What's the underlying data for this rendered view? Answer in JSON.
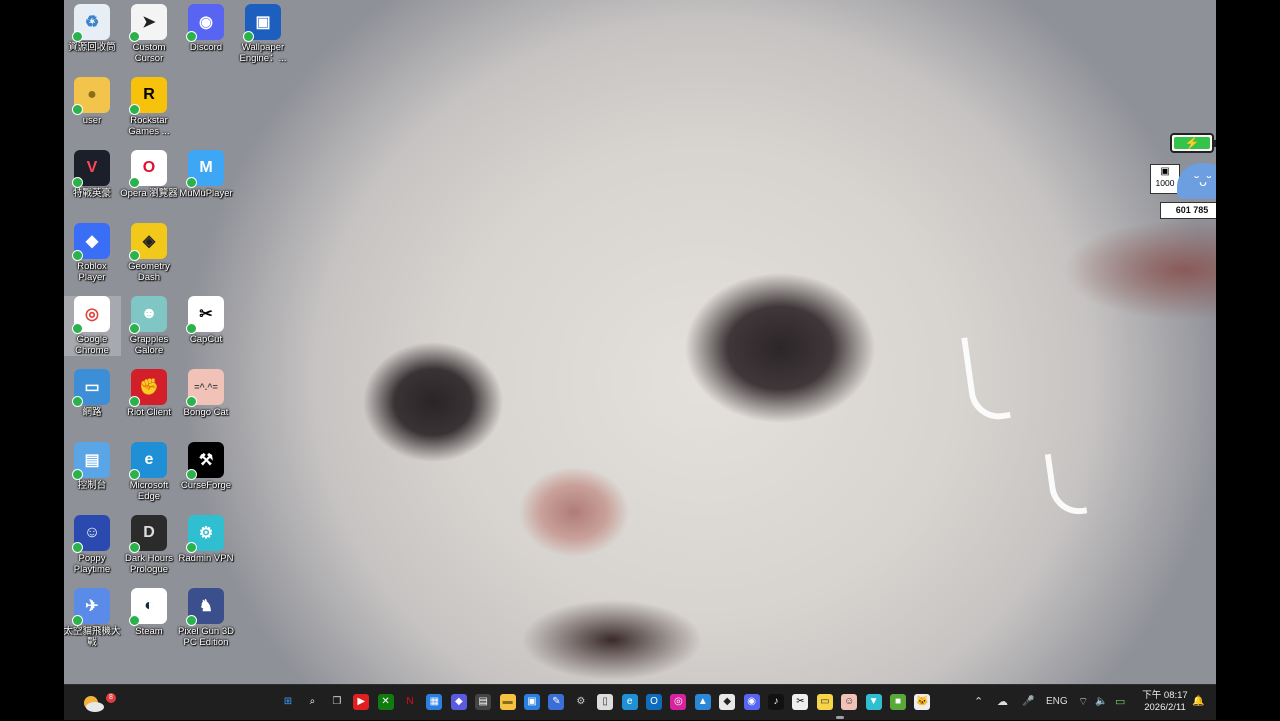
{
  "desktop_icons": [
    {
      "label": "資源回收筒",
      "name": "icon-recycle-bin",
      "glyph": "♻",
      "bg": "#e8eef5",
      "fg": "#3a86c8"
    },
    {
      "label": "Custom Cursor",
      "name": "icon-custom-cursor",
      "glyph": "➤",
      "bg": "#f4f4f4",
      "fg": "#222"
    },
    {
      "label": "Discord",
      "name": "icon-discord",
      "glyph": "◉",
      "bg": "#5865f2",
      "fg": "#fff"
    },
    {
      "label": "Wallpaper Engine：...",
      "name": "icon-wallpaper-engine",
      "glyph": "▣",
      "bg": "#1d5fbf",
      "fg": "#fff"
    },
    {
      "label": "user",
      "name": "icon-user-folder",
      "glyph": "●",
      "bg": "#f2c44b",
      "fg": "#8a6c1a"
    },
    {
      "label": "Rockstar Games ...",
      "name": "icon-rockstar",
      "glyph": "R",
      "bg": "#f7c20c",
      "fg": "#000"
    },
    {
      "label": "特戰英豪",
      "name": "icon-valorant",
      "glyph": "V",
      "bg": "#1b1f2a",
      "fg": "#ff4655"
    },
    {
      "label": "Opera 瀏覽器",
      "name": "icon-opera",
      "glyph": "O",
      "bg": "#ffffff",
      "fg": "#e0102e"
    },
    {
      "label": "MuMuPlayer",
      "name": "icon-mumuplayer",
      "glyph": "M",
      "bg": "#3da7f5",
      "fg": "#fff"
    },
    {
      "label": "Roblox Player",
      "name": "icon-roblox",
      "glyph": "◆",
      "bg": "#3b6ef6",
      "fg": "#fff"
    },
    {
      "label": "Geometry Dash",
      "name": "icon-geometry-dash",
      "glyph": "◈",
      "bg": "#f2c81b",
      "fg": "#222"
    },
    {
      "label": "Google Chrome",
      "name": "icon-google-chrome",
      "glyph": "◎",
      "bg": "#ffffff",
      "fg": "#db4437"
    },
    {
      "label": "Grapples Galore",
      "name": "icon-grapples-galore",
      "glyph": "☻",
      "bg": "#7fc6c4",
      "fg": "#fff"
    },
    {
      "label": "CapCut",
      "name": "icon-capcut",
      "glyph": "✂",
      "bg": "#ffffff",
      "fg": "#000"
    },
    {
      "label": "網路",
      "name": "icon-network",
      "glyph": "▭",
      "bg": "#3c8fd6",
      "fg": "#fff"
    },
    {
      "label": "Riot Client",
      "name": "icon-riot-client",
      "glyph": "✊",
      "bg": "#d31f2a",
      "fg": "#fff"
    },
    {
      "label": "Bongo Cat",
      "name": "icon-bongo-cat",
      "glyph": "=^.^=",
      "bg": "#f0c2b8",
      "fg": "#444"
    },
    {
      "label": "控制台",
      "name": "icon-control-panel",
      "glyph": "▤",
      "bg": "#5aa5e6",
      "fg": "#fff"
    },
    {
      "label": "Microsoft Edge",
      "name": "icon-microsoft-edge",
      "glyph": "e",
      "bg": "#1f8fd6",
      "fg": "#fff"
    },
    {
      "label": "CurseForge",
      "name": "icon-curseforge",
      "glyph": "⚒",
      "bg": "#000000",
      "fg": "#fff"
    },
    {
      "label": "Poppy Playtime",
      "name": "icon-poppy-playtime",
      "glyph": "☺",
      "bg": "#2a4ab0",
      "fg": "#fff"
    },
    {
      "label": "Dark Hours Prologue",
      "name": "icon-dark-hours",
      "glyph": "D",
      "bg": "#2b2b2b",
      "fg": "#ddd"
    },
    {
      "label": "Radmin VPN",
      "name": "icon-radmin-vpn",
      "glyph": "⚙",
      "bg": "#2fbfd0",
      "fg": "#fff"
    },
    {
      "label": "太空貓飛機大戰",
      "name": "icon-space-cat",
      "glyph": "✈",
      "bg": "#5a8be8",
      "fg": "#fff"
    },
    {
      "label": "Steam",
      "name": "icon-steam",
      "glyph": "◐",
      "bg": "#ffffff",
      "fg": "#1b2838"
    },
    {
      "label": "Pixel Gun 3D PC Edition",
      "name": "icon-pixel-gun",
      "glyph": "♞",
      "bg": "#3b4f8c",
      "fg": "#fff"
    }
  ],
  "widget": {
    "battery_glyph": "⚡",
    "left_count": "1000",
    "right_count": "1000",
    "total": "601 785",
    "cat_face": "˘ᴗ˘"
  },
  "taskbar": {
    "weather_badge": "8",
    "apps": [
      {
        "name": "start-button",
        "glyph": "⊞",
        "bg": "#1f1f1f",
        "fg": "#3aa0ff"
      },
      {
        "name": "search-button",
        "glyph": "⌕",
        "bg": "#1f1f1f",
        "fg": "#fff"
      },
      {
        "name": "task-view-button",
        "glyph": "❐",
        "bg": "#1f1f1f",
        "fg": "#ddd"
      },
      {
        "name": "youtube-app",
        "glyph": "▶",
        "bg": "#e02020",
        "fg": "#fff"
      },
      {
        "name": "xbox-app",
        "glyph": "✕",
        "bg": "#107c10",
        "fg": "#fff"
      },
      {
        "name": "netflix-app",
        "glyph": "N",
        "bg": "#1f1f1f",
        "fg": "#e50914"
      },
      {
        "name": "calendar-app",
        "glyph": "▦",
        "bg": "#2a7fe0",
        "fg": "#fff"
      },
      {
        "name": "copilot-app",
        "glyph": "◆",
        "bg": "#5b5be0",
        "fg": "#fff"
      },
      {
        "name": "calculator-app",
        "glyph": "▤",
        "bg": "#444",
        "fg": "#fff"
      },
      {
        "name": "file-explorer-app",
        "glyph": "▬",
        "bg": "#f5c242",
        "fg": "#8a6c1a"
      },
      {
        "name": "store-app",
        "glyph": "▣",
        "bg": "#2a7fe0",
        "fg": "#fff"
      },
      {
        "name": "whiteboard-app",
        "glyph": "✎",
        "bg": "#3a6fd8",
        "fg": "#fff"
      },
      {
        "name": "settings-app",
        "glyph": "⚙",
        "bg": "#1f1f1f",
        "fg": "#ccc"
      },
      {
        "name": "notepad-app",
        "glyph": "▯",
        "bg": "#ddd",
        "fg": "#333"
      },
      {
        "name": "edge-app",
        "glyph": "e",
        "bg": "#1f8fd6",
        "fg": "#fff"
      },
      {
        "name": "outlook-app",
        "glyph": "O",
        "bg": "#0f6cbd",
        "fg": "#fff"
      },
      {
        "name": "instagram-app",
        "glyph": "◎",
        "bg": "#d6249f",
        "fg": "#fff"
      },
      {
        "name": "photos-app",
        "glyph": "▲",
        "bg": "#2b88d8",
        "fg": "#fff"
      },
      {
        "name": "roblox-app",
        "glyph": "◆",
        "bg": "#e8e8e8",
        "fg": "#222"
      },
      {
        "name": "discord-app",
        "glyph": "◉",
        "bg": "#5865f2",
        "fg": "#fff"
      },
      {
        "name": "tiktok-app",
        "glyph": "♪",
        "bg": "#111",
        "fg": "#fff"
      },
      {
        "name": "capcut-app",
        "glyph": "✂",
        "bg": "#eee",
        "fg": "#000"
      },
      {
        "name": "sticky-notes-app",
        "glyph": "▭",
        "bg": "#f7d44a",
        "fg": "#333"
      },
      {
        "name": "bongo-cat-app",
        "glyph": "☺",
        "bg": "#f0c2b8",
        "fg": "#333"
      },
      {
        "name": "vpn-app",
        "glyph": "▼",
        "bg": "#2fbfd0",
        "fg": "#fff"
      },
      {
        "name": "minecraft-app",
        "glyph": "■",
        "bg": "#5aa83a",
        "fg": "#fff"
      },
      {
        "name": "cat-app",
        "glyph": "🐱",
        "bg": "#eee",
        "fg": "#333"
      }
    ],
    "tray": {
      "chevron": "⌃",
      "onedrive": "☁",
      "mic": "🎤",
      "language": "ENG",
      "wifi": "⌔",
      "volume": "🔈",
      "battery": "▭",
      "time": "下午 08:17",
      "date": "2026/2/11",
      "notification": "🔔"
    }
  }
}
